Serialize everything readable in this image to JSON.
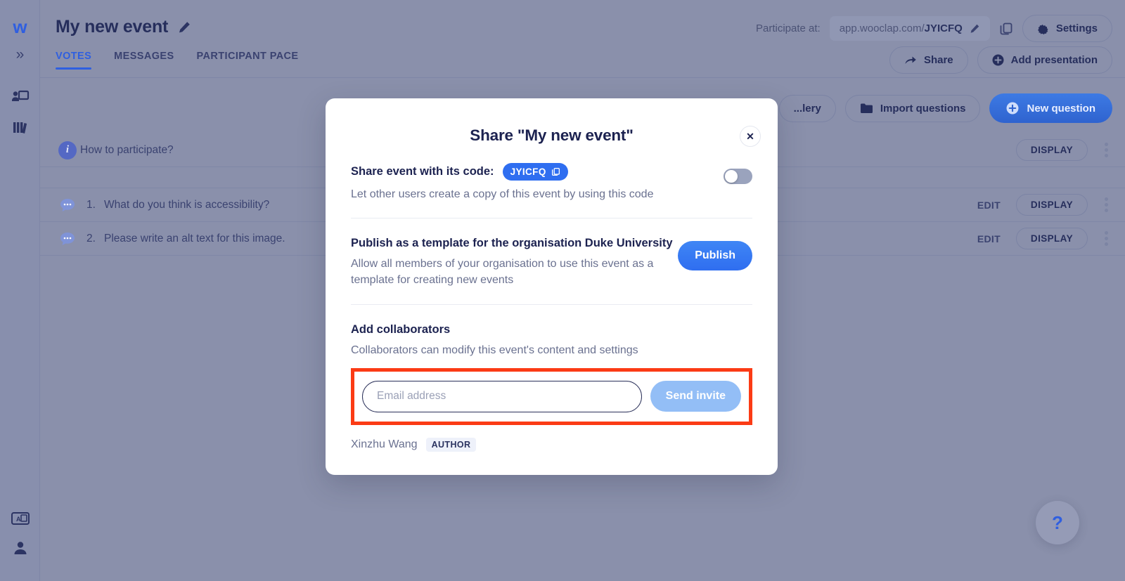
{
  "colors": {
    "accent_blue": "#2f6ef0",
    "navy": "#1c2250",
    "highlight_red": "#fb3b15",
    "backdrop": "#8a90ab"
  },
  "rail": {
    "logo": "w",
    "expand_icon": "chevrons-right-icon",
    "items": [
      {
        "name": "present-icon"
      },
      {
        "name": "library-icon"
      },
      {
        "name": "language-icon"
      },
      {
        "name": "user-icon"
      }
    ]
  },
  "header": {
    "event_title": "My new event",
    "edit_icon": "pencil-icon",
    "tabs": [
      {
        "label": "VOTES",
        "active": true
      },
      {
        "label": "MESSAGES",
        "active": false
      },
      {
        "label": "PARTICIPANT PACE",
        "active": false
      }
    ],
    "participate_label": "Participate at:",
    "participate_url_prefix": "app.wooclap.com/",
    "participate_code": "JYICFQ",
    "copy_link_icon": "copy-icon",
    "settings_label": "Settings",
    "settings_icon": "gear-icon",
    "share_label": "Share",
    "share_icon": "share-arrow-icon",
    "add_presentation_label": "Add presentation",
    "add_presentation_icon": "plus-circle-icon"
  },
  "toolbar": {
    "gallery_label": "...lery",
    "import_label": "Import questions",
    "import_icon": "folder-icon",
    "new_question_label": "New question",
    "new_question_icon": "plus-circle-icon"
  },
  "questions": {
    "info_row": {
      "icon": "info-icon",
      "text": "How to participate?",
      "display_label": "DISPLAY"
    },
    "rows": [
      {
        "icon": "chat-bubble-icon",
        "number": "1.",
        "text": "What do you think is accessibility?",
        "edit_label": "EDIT",
        "display_label": "DISPLAY"
      },
      {
        "icon": "chat-bubble-icon",
        "number": "2.",
        "text": "Please write an alt text for this image.",
        "edit_label": "EDIT",
        "display_label": "DISPLAY"
      }
    ]
  },
  "help": {
    "label": "?"
  },
  "modal": {
    "title": "Share \"My new event\"",
    "close_icon": "close-icon",
    "share_code": {
      "title": "Share event with its code:",
      "code": "JYICFQ",
      "copy_icon": "copy-icon",
      "subtitle": "Let other users create a copy of this event by using this code",
      "toggle_state": "off"
    },
    "publish": {
      "title": "Publish as a template for the organisation Duke University",
      "subtitle": "Allow all members of your organisation to use this event as a template for creating new events",
      "button_label": "Publish"
    },
    "collaborators": {
      "title": "Add collaborators",
      "subtitle": "Collaborators can modify this event's content and settings",
      "email_placeholder": "Email address",
      "email_value": "",
      "send_label": "Send invite",
      "people": [
        {
          "name": "Xinzhu Wang",
          "role": "AUTHOR"
        }
      ]
    }
  }
}
